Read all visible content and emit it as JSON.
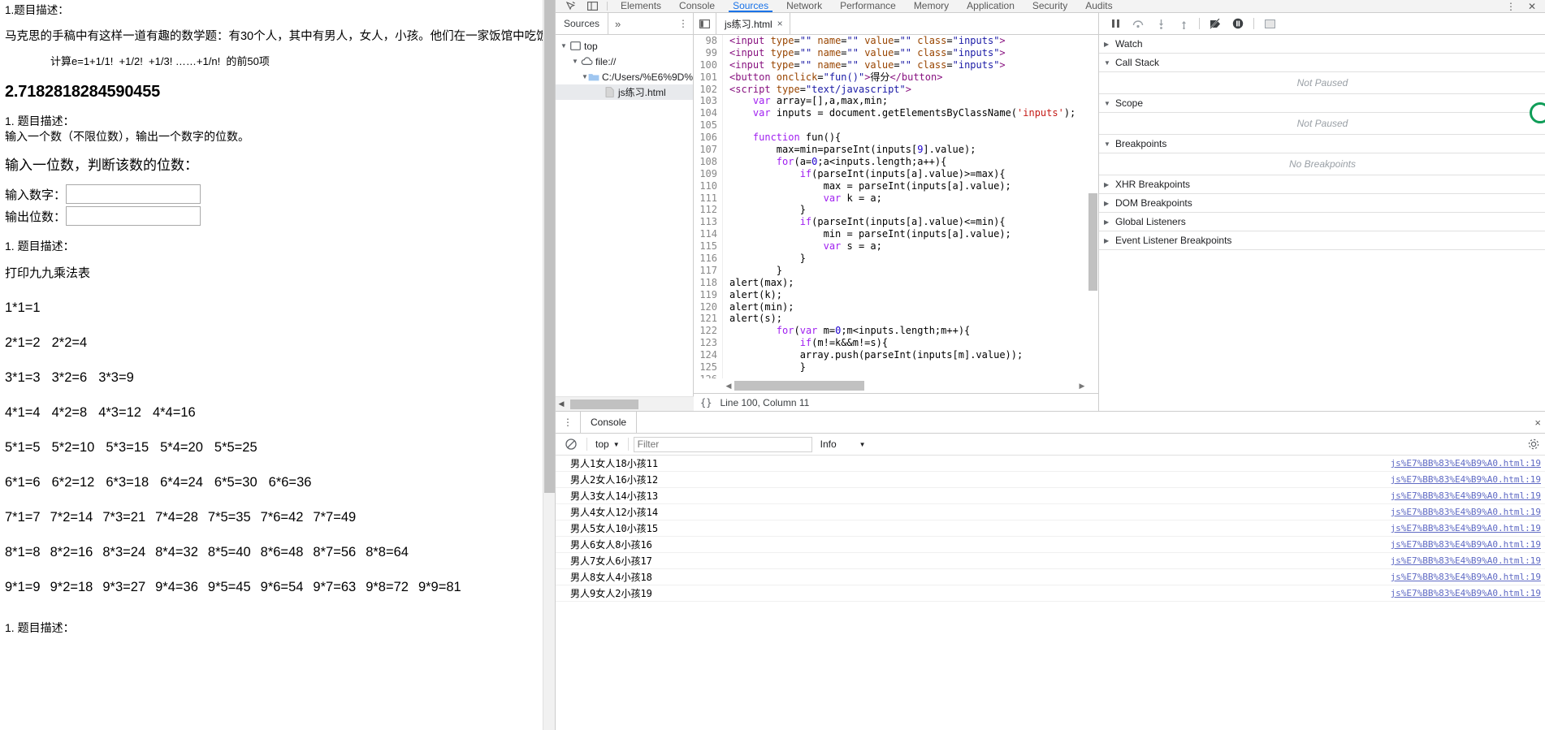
{
  "page": {
    "q1_heading": "1.题目描述：",
    "q1_body": "马克思的手稿中有这样一道有趣的数学题：有30个人，其中有男人，女人，小孩。他们在一家饭馆中吃饭，共花",
    "q1_formula": "计算e=1+1/1!  +1/2!  +1/3! ……+1/n!  的前50项",
    "e_value": "2.7182818284590455",
    "q2_heading": "1. 题目描述：",
    "q2_body": "输入一个数（不限位数），输出一个数字的位数。",
    "q2_prompt": "输入一位数，判断该数的位数：",
    "input_label": "输入数字：",
    "input_value": "",
    "output_label": "输出位数：",
    "output_value": "",
    "q3_heading": "1. 题目描述：",
    "q3_body": "打印九九乘法表",
    "multiplication_table": [
      [
        "1*1=1"
      ],
      [
        "2*1=2",
        "2*2=4"
      ],
      [
        "3*1=3",
        "3*2=6",
        "3*3=9"
      ],
      [
        "4*1=4",
        "4*2=8",
        "4*3=12",
        "4*4=16"
      ],
      [
        "5*1=5",
        "5*2=10",
        "5*3=15",
        "5*4=20",
        "5*5=25"
      ],
      [
        "6*1=6",
        "6*2=12",
        "6*3=18",
        "6*4=24",
        "6*5=30",
        "6*6=36"
      ],
      [
        "7*1=7",
        "7*2=14",
        "7*3=21",
        "7*4=28",
        "7*5=35",
        "7*6=42",
        "7*7=49"
      ],
      [
        "8*1=8",
        "8*2=16",
        "8*3=24",
        "8*4=32",
        "8*5=40",
        "8*6=48",
        "8*7=56",
        "8*8=64"
      ],
      [
        "9*1=9",
        "9*2=18",
        "9*3=27",
        "9*4=36",
        "9*5=45",
        "9*6=54",
        "9*7=63",
        "9*8=72",
        "9*9=81"
      ]
    ],
    "q4_heading": "1. 题目描述："
  },
  "devtools": {
    "main_tabs": [
      {
        "label": "Elements",
        "selected": false
      },
      {
        "label": "Console",
        "selected": false
      },
      {
        "label": "Sources",
        "selected": true
      },
      {
        "label": "Network",
        "selected": false
      },
      {
        "label": "Performance",
        "selected": false
      },
      {
        "label": "Memory",
        "selected": false
      },
      {
        "label": "Application",
        "selected": false
      },
      {
        "label": "Security",
        "selected": false
      },
      {
        "label": "Audits",
        "selected": false
      }
    ],
    "accent_color": "#1a73e8",
    "navigator": {
      "tab_label": "Sources",
      "more_glyph": "»",
      "menu_glyph": "⋮",
      "tree": [
        {
          "label": "top",
          "depth": 0,
          "icon": "frame-icon",
          "twisty": "▼",
          "selected": false
        },
        {
          "label": "file://",
          "depth": 1,
          "icon": "cloud-icon",
          "twisty": "▼",
          "selected": false
        },
        {
          "label": "C:/Users/%E6%9D%",
          "depth": 2,
          "icon": "folder-icon",
          "twisty": "▼",
          "selected": false
        },
        {
          "label": "js练习.html",
          "depth": 3,
          "icon": "file-icon",
          "twisty": "",
          "selected": true
        }
      ]
    },
    "editor": {
      "tab_label": "js练习.html",
      "tab_close": "×",
      "status_format_glyph": "{}",
      "status_text": "Line 100, Column 11",
      "first_line_number": 98,
      "lines": [
        {
          "n": 98,
          "tokens": [
            {
              "t": "tag",
              "v": "<input "
            },
            {
              "t": "attr",
              "v": "type"
            },
            {
              "t": "pl",
              "v": "="
            },
            {
              "t": "str",
              "v": "\"\""
            },
            {
              "t": "attr",
              "v": " name"
            },
            {
              "t": "pl",
              "v": "="
            },
            {
              "t": "str",
              "v": "\"\""
            },
            {
              "t": "attr",
              "v": " value"
            },
            {
              "t": "pl",
              "v": "="
            },
            {
              "t": "str",
              "v": "\"\""
            },
            {
              "t": "attr",
              "v": " class"
            },
            {
              "t": "pl",
              "v": "="
            },
            {
              "t": "str",
              "v": "\"inputs\""
            },
            {
              "t": "tag",
              "v": ">"
            }
          ]
        },
        {
          "n": 99,
          "tokens": [
            {
              "t": "tag",
              "v": "<input "
            },
            {
              "t": "attr",
              "v": "type"
            },
            {
              "t": "pl",
              "v": "="
            },
            {
              "t": "str",
              "v": "\"\""
            },
            {
              "t": "attr",
              "v": " name"
            },
            {
              "t": "pl",
              "v": "="
            },
            {
              "t": "str",
              "v": "\"\""
            },
            {
              "t": "attr",
              "v": " value"
            },
            {
              "t": "pl",
              "v": "="
            },
            {
              "t": "str",
              "v": "\"\""
            },
            {
              "t": "attr",
              "v": " class"
            },
            {
              "t": "pl",
              "v": "="
            },
            {
              "t": "str",
              "v": "\"inputs\""
            },
            {
              "t": "tag",
              "v": ">"
            }
          ]
        },
        {
          "n": 100,
          "tokens": [
            {
              "t": "tag",
              "v": "<input "
            },
            {
              "t": "attr",
              "v": "type"
            },
            {
              "t": "pl",
              "v": "="
            },
            {
              "t": "str",
              "v": "\"\""
            },
            {
              "t": "attr",
              "v": " name"
            },
            {
              "t": "pl",
              "v": "="
            },
            {
              "t": "str",
              "v": "\"\""
            },
            {
              "t": "attr",
              "v": " value"
            },
            {
              "t": "pl",
              "v": "="
            },
            {
              "t": "str",
              "v": "\"\""
            },
            {
              "t": "attr",
              "v": " class"
            },
            {
              "t": "pl",
              "v": "="
            },
            {
              "t": "str",
              "v": "\"inputs\""
            },
            {
              "t": "tag",
              "v": ">"
            }
          ]
        },
        {
          "n": 101,
          "tokens": [
            {
              "t": "tag",
              "v": "<button "
            },
            {
              "t": "attr",
              "v": "onclick"
            },
            {
              "t": "pl",
              "v": "="
            },
            {
              "t": "str",
              "v": "\"fun()\""
            },
            {
              "t": "tag",
              "v": ">"
            },
            {
              "t": "pl",
              "v": "得分"
            },
            {
              "t": "tag",
              "v": "</button>"
            }
          ]
        },
        {
          "n": 102,
          "tokens": [
            {
              "t": "tag",
              "v": "<script "
            },
            {
              "t": "attr",
              "v": "type"
            },
            {
              "t": "pl",
              "v": "="
            },
            {
              "t": "str",
              "v": "\"text/javascript\""
            },
            {
              "t": "tag",
              "v": ">"
            }
          ]
        },
        {
          "n": 103,
          "tokens": [
            {
              "t": "pl",
              "v": "    "
            },
            {
              "t": "kw",
              "v": "var"
            },
            {
              "t": "pl",
              "v": " array=[],a,max,min;"
            }
          ]
        },
        {
          "n": 104,
          "tokens": [
            {
              "t": "pl",
              "v": "    "
            },
            {
              "t": "kw",
              "v": "var"
            },
            {
              "t": "pl",
              "v": " inputs = document.getElementsByClassName("
            },
            {
              "t": "sq",
              "v": "'inputs'"
            },
            {
              "t": "pl",
              "v": ");"
            }
          ]
        },
        {
          "n": 105,
          "tokens": [
            {
              "t": "pl",
              "v": ""
            }
          ]
        },
        {
          "n": 106,
          "tokens": [
            {
              "t": "pl",
              "v": "    "
            },
            {
              "t": "kw",
              "v": "function"
            },
            {
              "t": "pl",
              "v": " fun(){"
            }
          ]
        },
        {
          "n": 107,
          "tokens": [
            {
              "t": "pl",
              "v": "        max=min=parseInt(inputs["
            },
            {
              "t": "num",
              "v": "9"
            },
            {
              "t": "pl",
              "v": "].value);"
            }
          ]
        },
        {
          "n": 108,
          "tokens": [
            {
              "t": "pl",
              "v": "        "
            },
            {
              "t": "kw",
              "v": "for"
            },
            {
              "t": "pl",
              "v": "(a="
            },
            {
              "t": "num",
              "v": "0"
            },
            {
              "t": "pl",
              "v": ";a<inputs.length;a++){"
            }
          ]
        },
        {
          "n": 109,
          "tokens": [
            {
              "t": "pl",
              "v": "            "
            },
            {
              "t": "kw",
              "v": "if"
            },
            {
              "t": "pl",
              "v": "(parseInt(inputs[a].value)>=max){"
            }
          ]
        },
        {
          "n": 110,
          "tokens": [
            {
              "t": "pl",
              "v": "                max = parseInt(inputs[a].value);"
            }
          ]
        },
        {
          "n": 111,
          "tokens": [
            {
              "t": "pl",
              "v": "                "
            },
            {
              "t": "kw",
              "v": "var"
            },
            {
              "t": "pl",
              "v": " k = a;"
            }
          ]
        },
        {
          "n": 112,
          "tokens": [
            {
              "t": "pl",
              "v": "            }"
            }
          ]
        },
        {
          "n": 113,
          "tokens": [
            {
              "t": "pl",
              "v": "            "
            },
            {
              "t": "kw",
              "v": "if"
            },
            {
              "t": "pl",
              "v": "(parseInt(inputs[a].value)<=min){"
            }
          ]
        },
        {
          "n": 114,
          "tokens": [
            {
              "t": "pl",
              "v": "                min = parseInt(inputs[a].value);"
            }
          ]
        },
        {
          "n": 115,
          "tokens": [
            {
              "t": "pl",
              "v": "                "
            },
            {
              "t": "kw",
              "v": "var"
            },
            {
              "t": "pl",
              "v": " s = a;"
            }
          ]
        },
        {
          "n": 116,
          "tokens": [
            {
              "t": "pl",
              "v": "            }"
            }
          ]
        },
        {
          "n": 117,
          "tokens": [
            {
              "t": "pl",
              "v": "        }"
            }
          ]
        },
        {
          "n": 118,
          "tokens": [
            {
              "t": "pl",
              "v": "alert(max);"
            }
          ]
        },
        {
          "n": 119,
          "tokens": [
            {
              "t": "pl",
              "v": "alert(k);"
            }
          ]
        },
        {
          "n": 120,
          "tokens": [
            {
              "t": "pl",
              "v": "alert(min);"
            }
          ]
        },
        {
          "n": 121,
          "tokens": [
            {
              "t": "pl",
              "v": "alert(s);"
            }
          ]
        },
        {
          "n": 122,
          "tokens": [
            {
              "t": "pl",
              "v": "        "
            },
            {
              "t": "kw",
              "v": "for"
            },
            {
              "t": "pl",
              "v": "("
            },
            {
              "t": "kw",
              "v": "var"
            },
            {
              "t": "pl",
              "v": " m="
            },
            {
              "t": "num",
              "v": "0"
            },
            {
              "t": "pl",
              "v": ";m<inputs.length;m++){"
            }
          ]
        },
        {
          "n": 123,
          "tokens": [
            {
              "t": "pl",
              "v": "            "
            },
            {
              "t": "kw",
              "v": "if"
            },
            {
              "t": "pl",
              "v": "(m!=k&&m!=s){"
            }
          ]
        },
        {
          "n": 124,
          "tokens": [
            {
              "t": "pl",
              "v": "            array.push(parseInt(inputs[m].value));"
            }
          ]
        },
        {
          "n": 125,
          "tokens": [
            {
              "t": "pl",
              "v": "            }"
            }
          ]
        },
        {
          "n": 126,
          "tokens": [
            {
              "t": "pl",
              "v": ""
            }
          ]
        }
      ]
    },
    "debugger": {
      "toolbar_icons": [
        "pause-icon",
        "step-over-icon",
        "step-into-icon",
        "step-out-icon",
        "deactivate-breakpoints-icon",
        "pause-on-exceptions-icon",
        "panel-toggle-icon"
      ],
      "sections": [
        {
          "label": "Watch",
          "expanded": false,
          "empty": null
        },
        {
          "label": "Call Stack",
          "expanded": true,
          "empty": "Not Paused"
        },
        {
          "label": "Scope",
          "expanded": true,
          "empty": "Not Paused"
        },
        {
          "label": "Breakpoints",
          "expanded": true,
          "empty": "No Breakpoints"
        },
        {
          "label": "XHR Breakpoints",
          "expanded": false,
          "empty": null
        },
        {
          "label": "DOM Breakpoints",
          "expanded": false,
          "empty": null
        },
        {
          "label": "Global Listeners",
          "expanded": false,
          "empty": null
        },
        {
          "label": "Event Listener Breakpoints",
          "expanded": false,
          "empty": null
        }
      ]
    },
    "drawer": {
      "menu_glyph": "⋮",
      "tab_label": "Console",
      "close_glyph": "×",
      "clear_glyph": "⃠",
      "context_label": "top",
      "context_caret": "▼",
      "filter_placeholder": "Filter",
      "filter_value": "",
      "level_label": "Info",
      "level_caret": "▼",
      "settings_glyph": "⚙",
      "messages": [
        {
          "text": "男人1女人18小孩11",
          "source": "js%E7%BB%83%E4%B9%A0.html:19"
        },
        {
          "text": "男人2女人16小孩12",
          "source": "js%E7%BB%83%E4%B9%A0.html:19"
        },
        {
          "text": "男人3女人14小孩13",
          "source": "js%E7%BB%83%E4%B9%A0.html:19"
        },
        {
          "text": "男人4女人12小孩14",
          "source": "js%E7%BB%83%E4%B9%A0.html:19"
        },
        {
          "text": "男人5女人10小孩15",
          "source": "js%E7%BB%83%E4%B9%A0.html:19"
        },
        {
          "text": "男人6女人8小孩16",
          "source": "js%E7%BB%83%E4%B9%A0.html:19"
        },
        {
          "text": "男人7女人6小孩17",
          "source": "js%E7%BB%83%E4%B9%A0.html:19"
        },
        {
          "text": "男人8女人4小孩18",
          "source": "js%E7%BB%83%E4%B9%A0.html:19"
        },
        {
          "text": "男人9女人2小孩19",
          "source": "js%E7%BB%83%E4%B9%A0.html:19"
        }
      ]
    }
  }
}
